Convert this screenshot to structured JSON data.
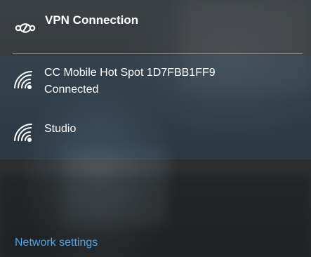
{
  "vpn": {
    "title": "VPN Connection",
    "icon": "vpn-icon"
  },
  "networks": [
    {
      "name": "CC Mobile Hot Spot 1D7FBB1FF9",
      "status": "Connected",
      "icon": "wifi-icon",
      "selected": true
    },
    {
      "name": "Studio",
      "icon": "wifi-icon",
      "selected": false
    }
  ],
  "footer": {
    "settings_link": "Network settings"
  },
  "colors": {
    "accent": "#4ea3e8",
    "text": "#ffffff"
  }
}
